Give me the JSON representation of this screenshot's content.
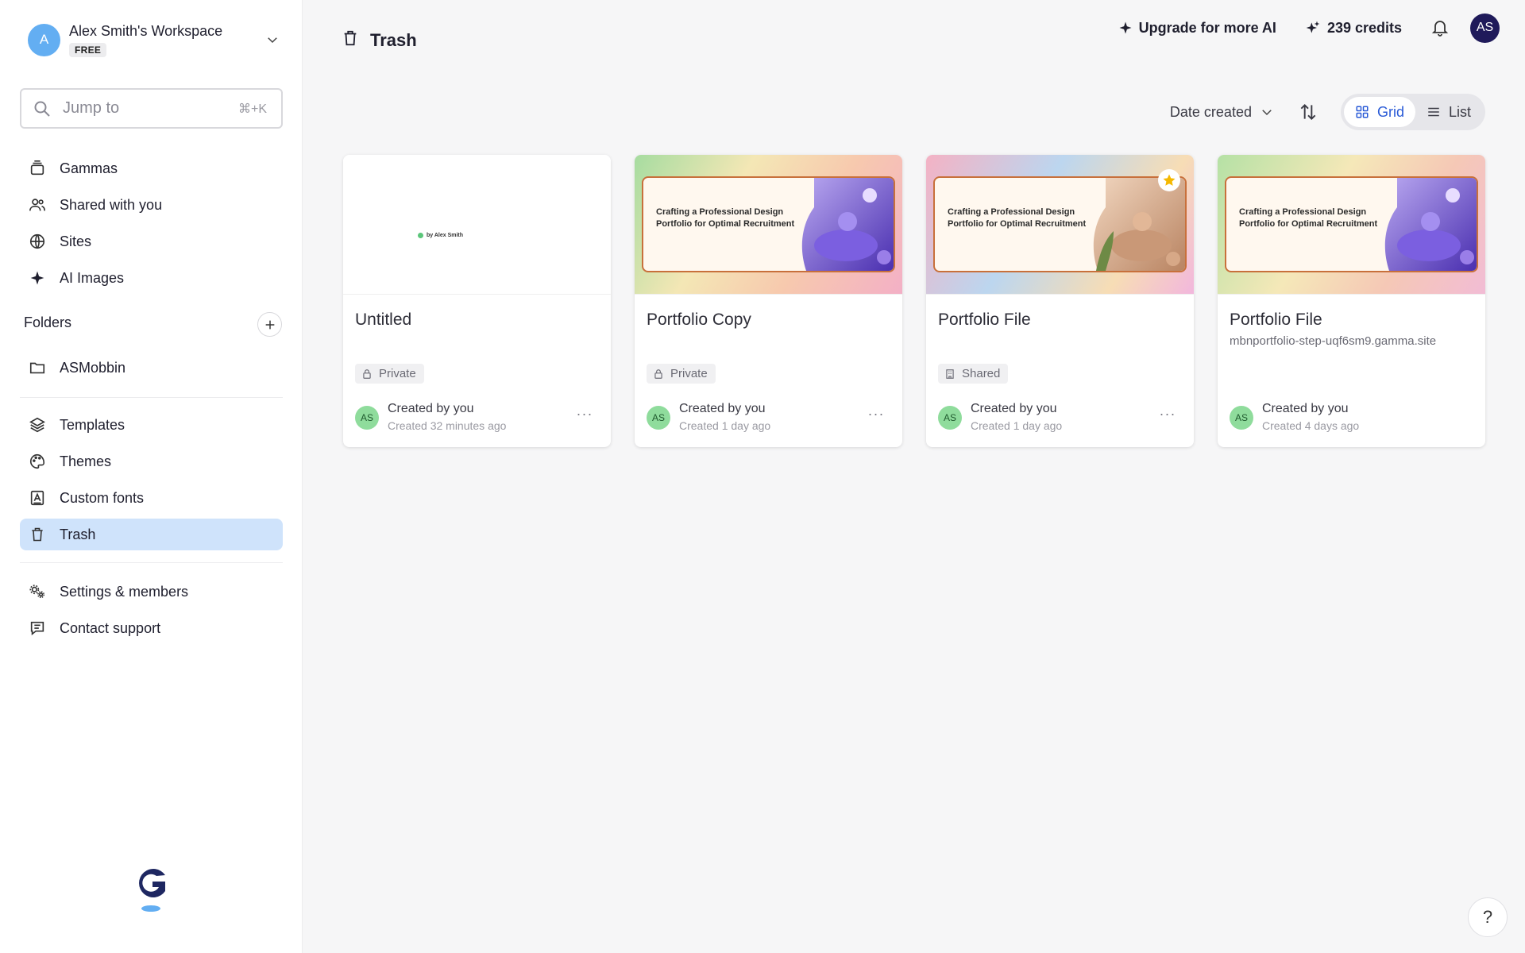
{
  "workspace": {
    "initial": "A",
    "name": "Alex Smith's Workspace",
    "plan": "FREE"
  },
  "search": {
    "placeholder": "Jump to",
    "shortcut": "⌘+K"
  },
  "nav": {
    "gammas": "Gammas",
    "shared": "Shared with you",
    "sites": "Sites",
    "ai_images": "AI Images",
    "folders_heading": "Folders",
    "folder_1": "ASMobbin",
    "templates": "Templates",
    "themes": "Themes",
    "custom_fonts": "Custom fonts",
    "trash": "Trash",
    "settings": "Settings & members",
    "support": "Contact support"
  },
  "header": {
    "title": "Trash",
    "upgrade": "Upgrade for more AI",
    "credits": "239 credits",
    "user_initials": "AS"
  },
  "toolbar": {
    "sort_label": "Date created",
    "grid": "Grid",
    "list": "List"
  },
  "slide_heading": "Crafting a Professional Design Portfolio for Optimal Recruitment",
  "blank_slide_byline": "by Alex Smith",
  "cards": [
    {
      "title": "Untitled",
      "subtitle": "",
      "visibility": "Private",
      "creator": "Created by you",
      "created": "Created 32 minutes ago",
      "initials": "AS"
    },
    {
      "title": "Portfolio Copy",
      "subtitle": "",
      "visibility": "Private",
      "creator": "Created by you",
      "created": "Created 1 day ago",
      "initials": "AS"
    },
    {
      "title": "Portfolio File",
      "subtitle": "",
      "visibility": "Shared",
      "creator": "Created by you",
      "created": "Created 1 day ago",
      "initials": "AS"
    },
    {
      "title": "Portfolio File",
      "subtitle": "mbnportfolio-step-uqf6sm9.gamma.site",
      "visibility": "",
      "creator": "Created by you",
      "created": "Created 4 days ago",
      "initials": "AS"
    }
  ],
  "help_label": "?",
  "colors": {
    "active_nav": "#cfe3fb",
    "accent": "#2a5bd7",
    "avatar": "#8fdc9c"
  }
}
